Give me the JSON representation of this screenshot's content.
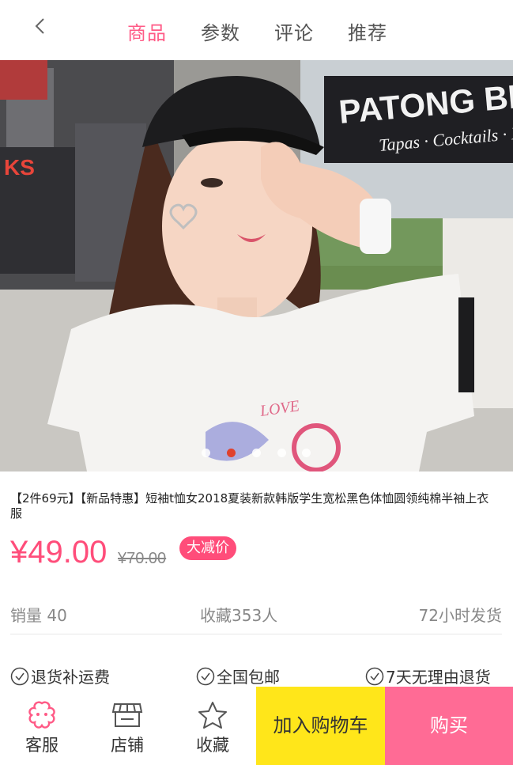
{
  "nav": {
    "tabs": [
      "商品",
      "参数",
      "评论",
      "推荐"
    ]
  },
  "hero": {
    "sign_text_1": "PATONG BEACH",
    "sign_text_2": "Tapas · Cocktails · M",
    "left_sign": "KS",
    "shirt_text": "LOVE",
    "dots_count": 5,
    "active_dot_index": 1
  },
  "product": {
    "title": "【2件69元】【新品特惠】短袖t恤女2018夏装新款韩版学生宽松黑色体恤圆领纯棉半袖上衣服",
    "price": "¥49.00",
    "original_price": "¥70.00",
    "badge": "大减价"
  },
  "stats": {
    "sales": "销量 40",
    "favorites": "收藏353人",
    "shipping": "72小时发货"
  },
  "services": [
    "退货补运费",
    "全国包邮",
    "7天无理由退货"
  ],
  "bottom": {
    "service": "客服",
    "shop": "店铺",
    "collect": "收藏",
    "add_cart": "加入购物车",
    "buy": "购买"
  },
  "colors": {
    "accent": "#ff5a86",
    "cart_button": "#ffe61a",
    "buy_button": "#ff6b95"
  }
}
